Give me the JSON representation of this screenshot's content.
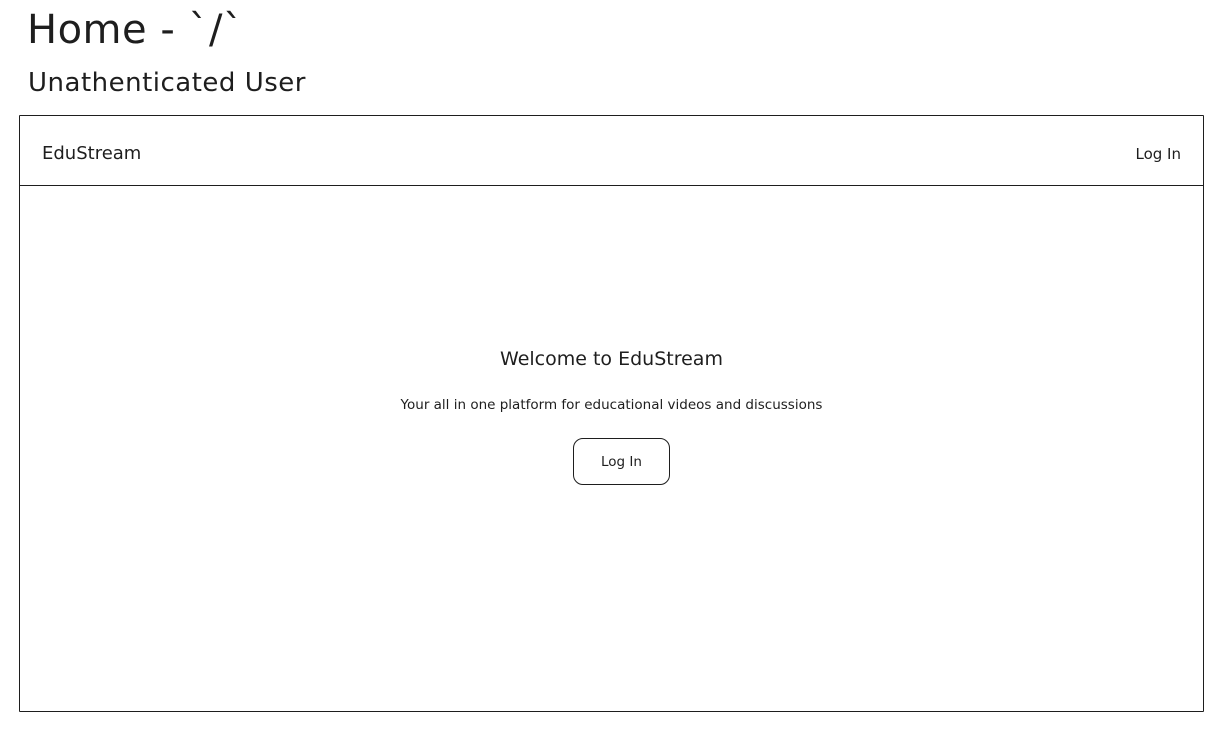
{
  "header": {
    "title": "Home - `/`",
    "subtitle": "Unathenticated User"
  },
  "navbar": {
    "brand": "EduStream",
    "login_label": "Log In"
  },
  "hero": {
    "title": "Welcome to EduStream",
    "description": "Your all in one platform for educational videos and discussions",
    "button_label": "Log In"
  }
}
